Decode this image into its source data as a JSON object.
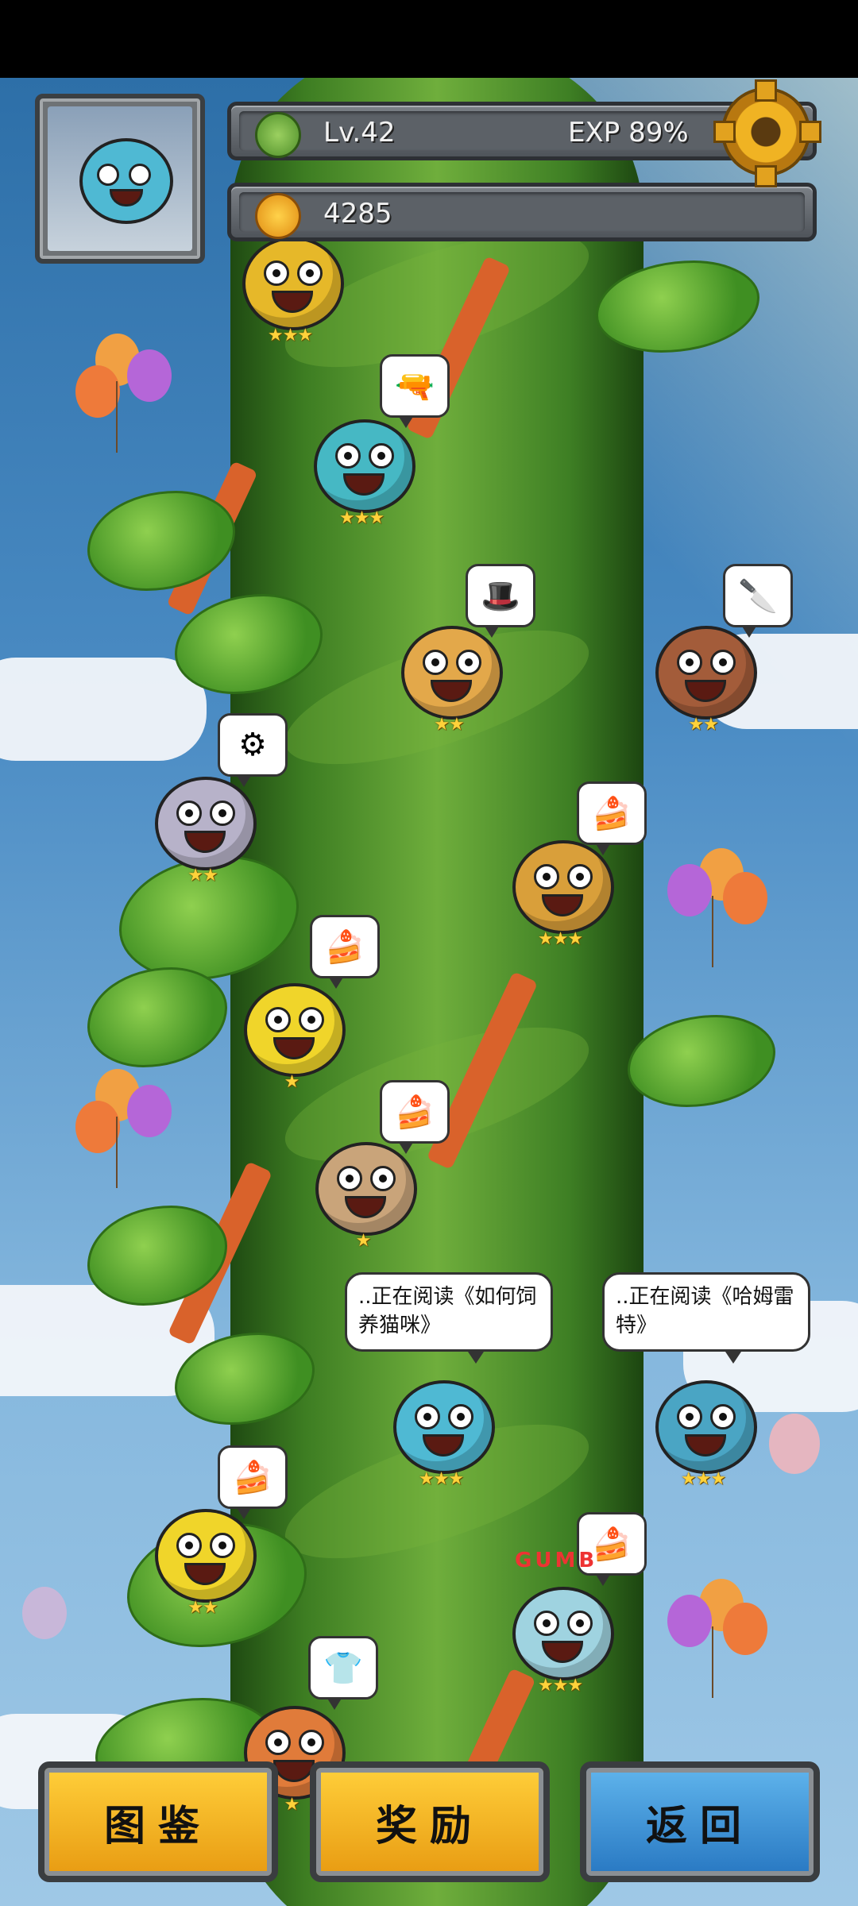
{
  "hud": {
    "level": "Lv.42",
    "exp": "EXP 89%",
    "currency": "4285",
    "level_icon": "tree-icon",
    "currency_icon": "fruit-icon",
    "settings_icon": "gear-icon"
  },
  "characters": [
    {
      "id": "top-left",
      "stars": "★★★"
    },
    {
      "id": "tier-2",
      "stars": "★★★",
      "bubble": "🔫"
    },
    {
      "id": "tier-3-center",
      "stars": "★★",
      "bubble": "🎩"
    },
    {
      "id": "tier-3-right",
      "stars": "★★",
      "bubble": "🔪"
    },
    {
      "id": "tier-4-left",
      "stars": "★★",
      "bubble": "⚙"
    },
    {
      "id": "tier-4-right",
      "stars": "★★★",
      "bubble": "🍰"
    },
    {
      "id": "tier-5",
      "stars": "★",
      "bubble": "🍰"
    },
    {
      "id": "tier-6",
      "stars": "★",
      "bubble": "🍰"
    },
    {
      "id": "tier-7-center",
      "stars": "★★★",
      "speech": "..正在阅读《如何饲养猫咪》"
    },
    {
      "id": "tier-7-right",
      "stars": "★★★",
      "speech": "..正在阅读《哈姆雷特》"
    },
    {
      "id": "tier-8-left",
      "stars": "★★",
      "bubble": "🍰"
    },
    {
      "id": "tier-8-right",
      "stars": "★★★",
      "bubble": "🍰",
      "sign": "GUMB"
    },
    {
      "id": "tier-9",
      "stars": "★",
      "bubble": "👕"
    }
  ],
  "buttons": {
    "handbook": "图鉴",
    "rewards": "奖励",
    "back": "返回"
  },
  "colors": {
    "gold_button": "#f0b323",
    "blue_button": "#3d93d6",
    "star": "#ffd23a"
  }
}
